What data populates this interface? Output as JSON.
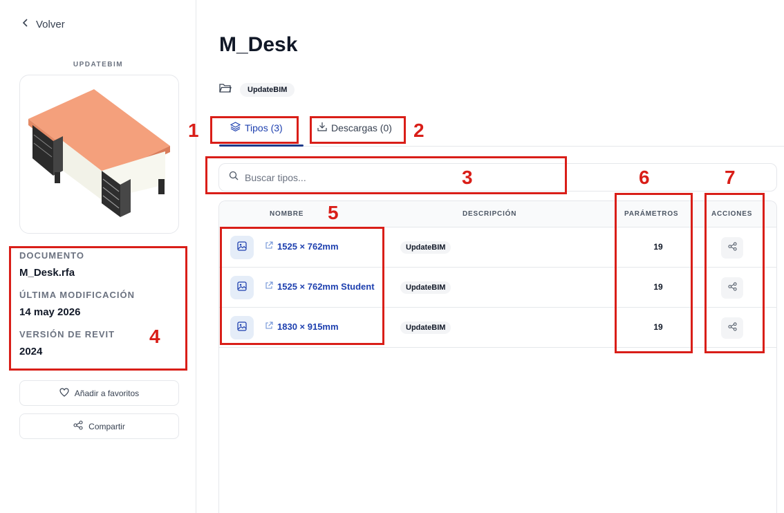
{
  "sidebar": {
    "back_label": "Volver",
    "brand": "UPDATEBIM",
    "document_label": "DOCUMENTO",
    "document_value": "M_Desk.rfa",
    "modified_label": "ÚLTIMA MODIFICACIÓN",
    "modified_value": "14 may 2026",
    "revit_label": "VERSIÓN DE REVIT",
    "revit_value": "2024",
    "favorites_label": "Añadir a favoritos",
    "share_label": "Compartir"
  },
  "main": {
    "title": "M_Desk",
    "folder_chip": "UpdateBIM",
    "tabs": [
      {
        "label": "Tipos (3)",
        "icon": "layers-icon",
        "active": true
      },
      {
        "label": "Descargas (0)",
        "icon": "download-icon",
        "active": false
      }
    ],
    "search": {
      "placeholder": "Buscar tipos..."
    },
    "table": {
      "headers": {
        "name": "NOMBRE",
        "description": "DESCRIPCIÓN",
        "parameters": "PARÁMETROS",
        "actions": "ACCIONES"
      },
      "rows": [
        {
          "name": "1525 × 762mm",
          "description": "UpdateBIM",
          "parameters": "19"
        },
        {
          "name": "1525 × 762mm Student",
          "description": "UpdateBIM",
          "parameters": "19"
        },
        {
          "name": "1830 × 915mm",
          "description": "UpdateBIM",
          "parameters": "19"
        }
      ]
    }
  },
  "annotations": [
    "1",
    "2",
    "3",
    "4",
    "5",
    "6",
    "7"
  ],
  "colors": {
    "accent": "#1e40af",
    "annotation": "#d91e18",
    "desk_top": "#f4a07c"
  }
}
